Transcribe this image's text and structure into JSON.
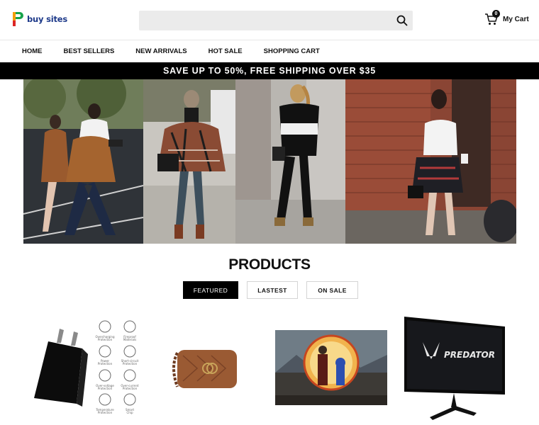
{
  "header": {
    "logo_text": "buy sites",
    "search_placeholder": "",
    "cart_count": "0",
    "cart_label": "My Cart"
  },
  "nav": {
    "items": [
      "HOME",
      "BEST SELLERS",
      "NEW ARRIVALS",
      "HOT SALE",
      "SHOPPING CART"
    ]
  },
  "promo": {
    "text": "SAVE UP TO 50%, FREE SHIPPING OVER $35"
  },
  "products": {
    "title": "PRODUCTS",
    "tabs": [
      "FEATURED",
      "LASTEST",
      "ON SALE"
    ],
    "active_tab": "FEATURED",
    "items": [
      {
        "name": "charger",
        "features": [
          "Overcharging Protection",
          "Fireproof Materials",
          "Power Protection",
          "Short-circuit Protection",
          "Over-voltage Protection",
          "Over-current Protection",
          "Temperature Protection",
          "Smart Chip"
        ]
      },
      {
        "name": "handbag"
      },
      {
        "name": "movie-poster"
      },
      {
        "name": "monitor",
        "brand_text": "PREDATOR"
      }
    ]
  },
  "colors": {
    "brand_blue": "#1e3a8a",
    "promo_bg": "#000000",
    "search_bg": "#ebebeb"
  }
}
